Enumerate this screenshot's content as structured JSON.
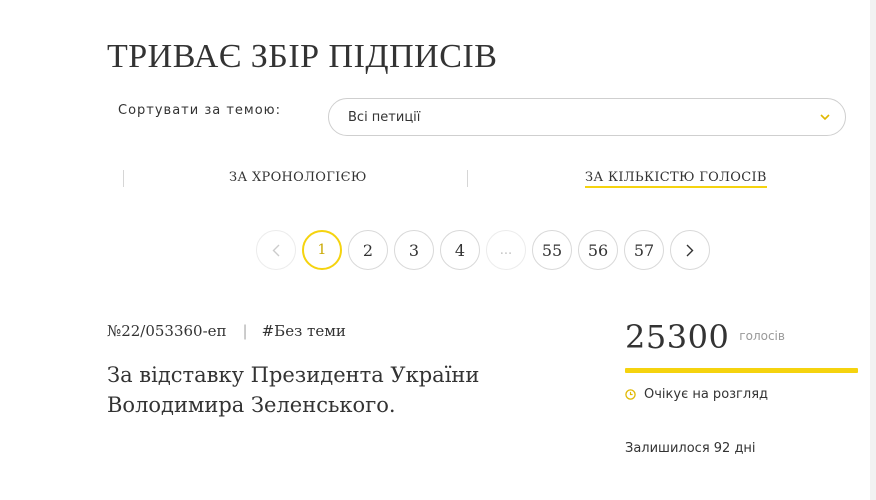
{
  "header": {
    "title": "ТРИВАЄ ЗБІР ПІДПИСІВ"
  },
  "sort": {
    "label": "Сортувати за темою:",
    "selected": "Всі петиції"
  },
  "tabs": [
    {
      "label": "ЗА ХРОНОЛОГІЄЮ",
      "active": false
    },
    {
      "label": "ЗА КІЛЬКІСТЮ ГОЛОСІВ",
      "active": true
    }
  ],
  "pagination": {
    "prev_icon": "chevron-left-icon",
    "next_icon": "chevron-right-icon",
    "pages": [
      "1",
      "2",
      "3",
      "4",
      "...",
      "55",
      "56",
      "57"
    ],
    "current": "1"
  },
  "petition": {
    "number": "№22/053360-еп",
    "tag": "#Без теми",
    "title": "За відставку Президента України Володимира Зеленського.",
    "votes": "25300",
    "votes_unit": "голосів",
    "progress_fraction": 1.0,
    "status": "Очікує на розгляд",
    "remaining": "Залишилося 92 дні"
  },
  "colors": {
    "accent": "#f5d30f",
    "text": "#333333",
    "border": "#d9d9d9"
  }
}
